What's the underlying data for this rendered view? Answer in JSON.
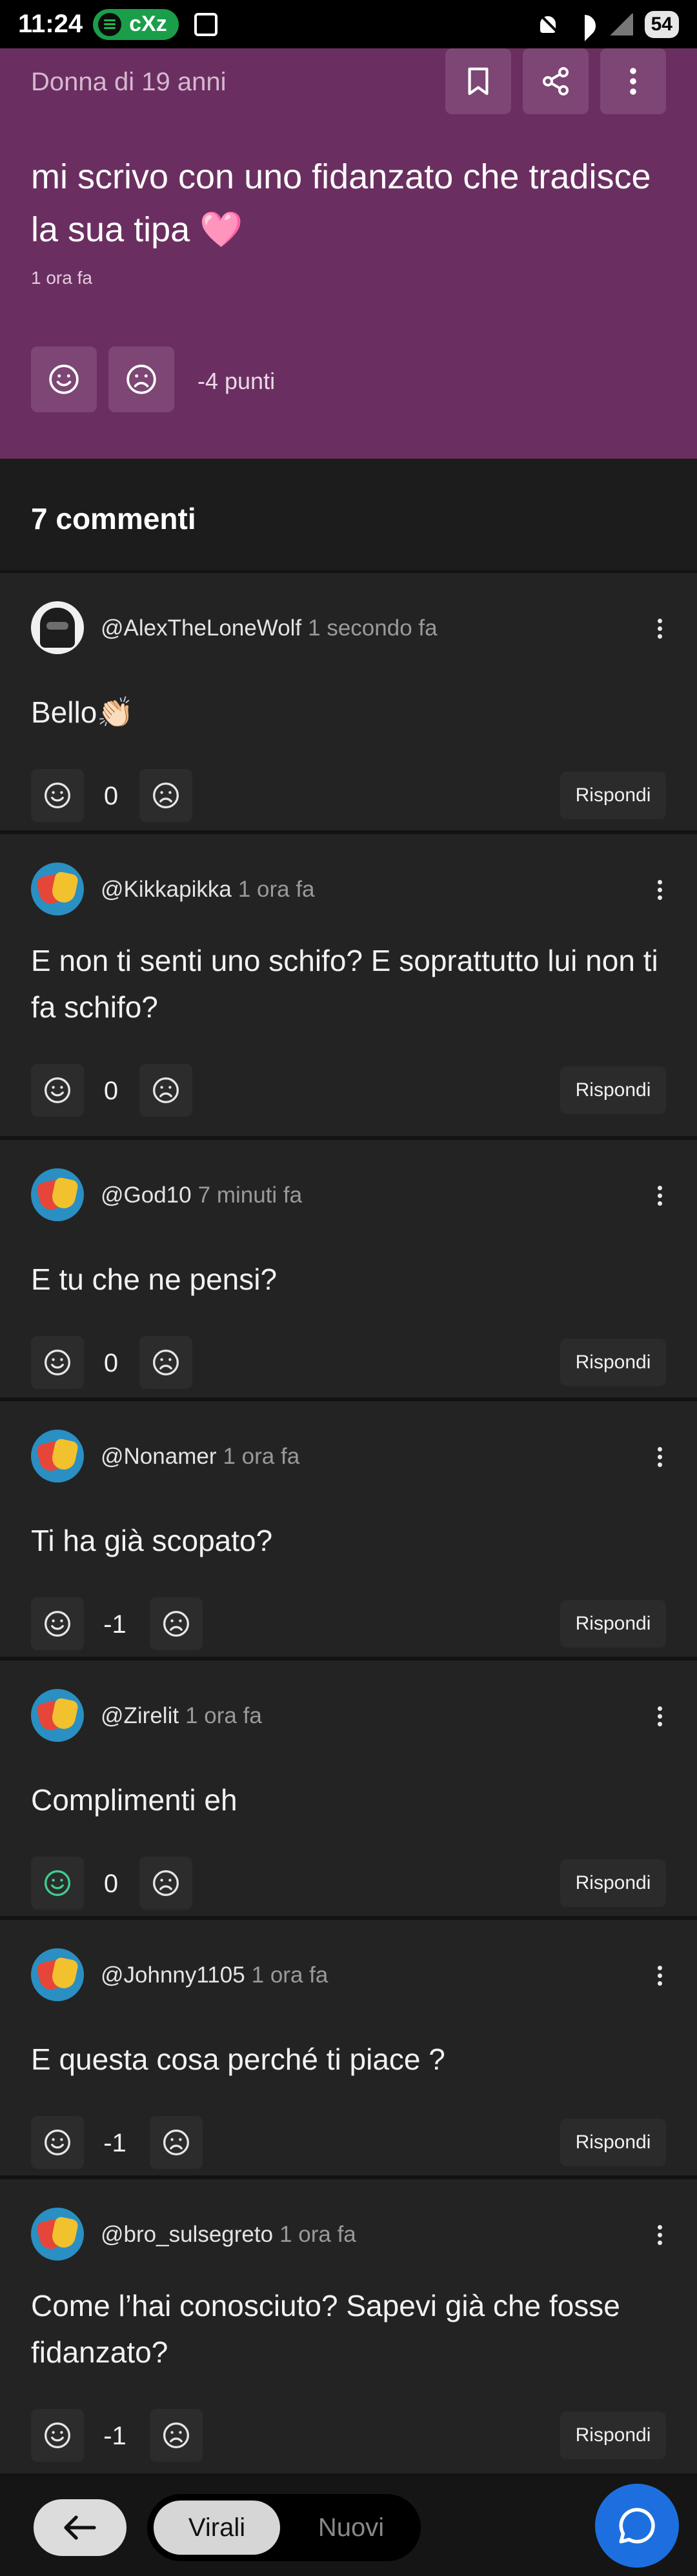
{
  "status_bar": {
    "time": "11:24",
    "media_badge": "cXz",
    "battery": "54",
    "icons": [
      "spotify-icon",
      "screenshot-icon",
      "mute-icon",
      "wifi-icon",
      "signal-icon"
    ]
  },
  "post": {
    "author": "Donna di 19 anni",
    "text": "mi scrivo con uno fidanzato che tradisce la sua tipa 🩷",
    "time": "1 ora fa",
    "points": "-4 punti",
    "actions": [
      "bookmark-icon",
      "share-icon",
      "more-icon"
    ]
  },
  "comments_header": "7 commenti",
  "comments": [
    {
      "user": "@AlexTheLoneWolf",
      "time": "1 secondo fa",
      "text": "Bello👏🏻",
      "score": "0",
      "reply": "Rispondi"
    },
    {
      "user": "@Kikkapikka",
      "time": "1 ora fa",
      "text": "E non ti senti uno schifo? E soprattutto lui non ti fa schifo?",
      "score": "0",
      "reply": "Rispondi"
    },
    {
      "user": "@God10",
      "time": "7 minuti fa",
      "text": "E tu che ne pensi?",
      "score": "0",
      "reply": "Rispondi"
    },
    {
      "user": "@Nonamer",
      "time": "1 ora fa",
      "text": "Ti ha già scopato?",
      "score": "-1",
      "reply": "Rispondi"
    },
    {
      "user": "@Zirelit",
      "time": "1 ora fa",
      "text": "Complimenti eh",
      "score": "0",
      "reply": "Rispondi",
      "upvoted": true
    },
    {
      "user": "@Johnny1105",
      "time": "1 ora fa",
      "text": "E questa cosa perché ti piace ?",
      "score": "-1",
      "reply": "Rispondi"
    },
    {
      "user": "@bro_sulsegreto",
      "time": "1 ora fa",
      "text": "Come l’hai conosciuto? Sapevi già che fosse fidanzato?",
      "score": "-1",
      "reply": "Rispondi"
    }
  ],
  "bottom_nav": {
    "tab_active": "Virali",
    "tab_inactive": "Nuovi",
    "back_icon": "arrow-left-icon",
    "chat_icon": "chat-bubble-icon"
  },
  "colors": {
    "post_bg": "#6a2f60",
    "card_bg": "#232323",
    "fab": "#1d6fe0",
    "upvote_active": "#3ecf8e"
  }
}
